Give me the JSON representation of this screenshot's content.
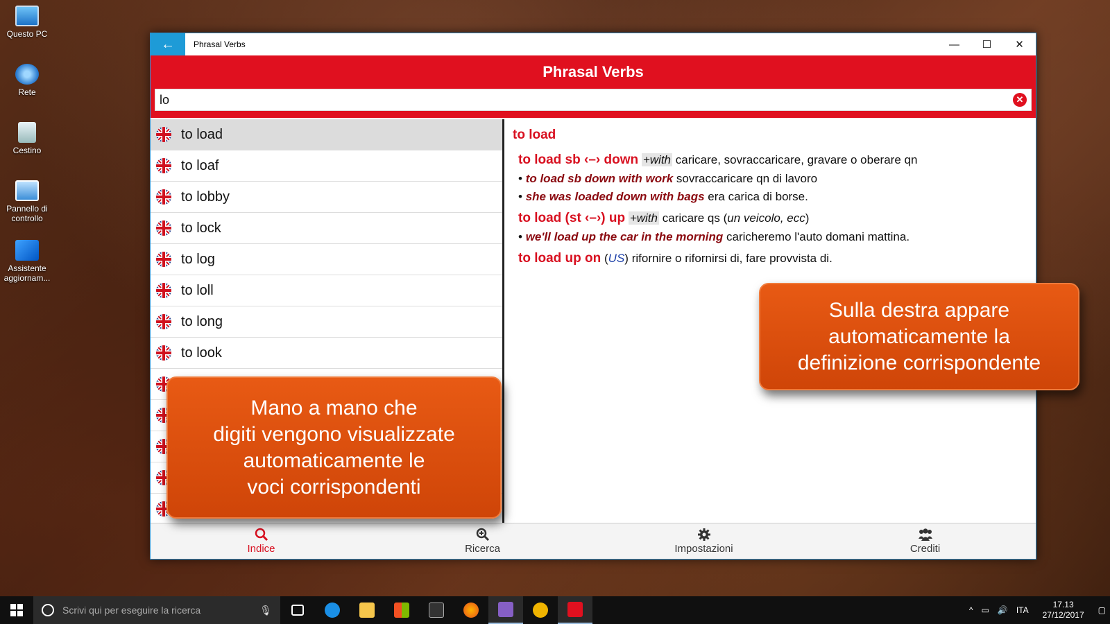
{
  "desktop": {
    "icons": [
      {
        "label": "Questo PC"
      },
      {
        "label": "Rete"
      },
      {
        "label": "Cestino"
      },
      {
        "label": "Pannello di controllo"
      },
      {
        "label": "Assistente aggiornam..."
      }
    ]
  },
  "window": {
    "back_glyph": "←",
    "title": "Phrasal Verbs",
    "minimize_glyph": "—",
    "maximize_glyph": "☐",
    "close_glyph": "✕"
  },
  "app": {
    "header": "Phrasal Verbs",
    "search": {
      "value": "lo",
      "clear_glyph": "✕"
    }
  },
  "index_list": {
    "selected": "to load",
    "items": [
      "to load",
      "to loaf",
      "to lobby",
      "to lock",
      "to log",
      "to loll",
      "to long",
      "to look",
      "",
      "",
      "",
      "",
      ""
    ]
  },
  "definition": {
    "headword": "to load",
    "entries": [
      {
        "phrase": "to load sb ‹–› down",
        "tag": "+with",
        "meaning": "caricare, sovraccaricare, gravare o oberare qn",
        "examples": [
          {
            "bullet": "•",
            "en": "to load sb down with work",
            "it": "sovraccaricare qn di lavoro"
          },
          {
            "bullet": "•",
            "en": "she was loaded down with bags",
            "it": "era carica di borse."
          }
        ]
      },
      {
        "phrase": "to load (st ‹–›) up",
        "tag": "+with",
        "meaning_pre": "caricare qs (",
        "meaning_ital": "un veicolo, ecc",
        "meaning_post": ")",
        "examples": [
          {
            "bullet": "•",
            "en": "we'll load up the car in the morning",
            "it": "caricheremo l'auto domani mattina."
          }
        ]
      },
      {
        "phrase": "to load up on",
        "paren_open": "(",
        "region": "US",
        "paren_close": ")",
        "meaning": "rifornire o rifornirsi di, fare provvista di."
      }
    ]
  },
  "bottom_nav": [
    {
      "label": "Indice",
      "icon": "search-icon",
      "active": true
    },
    {
      "label": "Ricerca",
      "icon": "zoom-in-icon",
      "active": false
    },
    {
      "label": "Impostazioni",
      "icon": "gear-icon",
      "active": false
    },
    {
      "label": "Crediti",
      "icon": "people-icon",
      "active": false
    }
  ],
  "callouts": {
    "left": [
      "Mano a mano che",
      "digiti vengono visualizzate",
      "automaticamente le",
      "voci corrispondenti"
    ],
    "right": [
      "Sulla destra appare",
      "automaticamente la",
      "definizione corrispondente"
    ]
  },
  "taskbar": {
    "search_placeholder": "Scrivi qui per eseguire la ricerca",
    "language": "ITA",
    "time": "17.13",
    "date": "27/12/2017"
  },
  "colors": {
    "accent_red": "#e0101f",
    "titlebar_blue": "#1e9bd7",
    "callout_orange": "#e0520f"
  }
}
